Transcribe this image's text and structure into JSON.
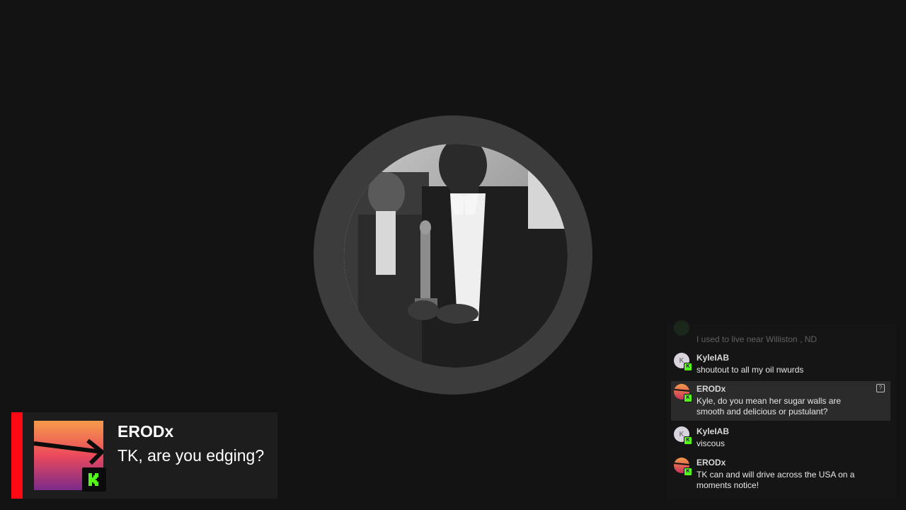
{
  "featured": {
    "username": "ERODx",
    "message": "TK, are you edging?",
    "platform_icon": "kick-logo-icon",
    "accent_color": "#ff0a14"
  },
  "chat": {
    "messages": [
      {
        "user": "",
        "text": "I used to live near Williston , ND",
        "faded": true
      },
      {
        "user": "KyleIAB",
        "text": "shoutout to all my oil nwurds",
        "avatar_letter": "K"
      },
      {
        "user": "ERODx",
        "text": "Kyle, do you mean her sugar walls are smooth and delicious or pustulant?",
        "highlight": true
      },
      {
        "user": "KyleIAB",
        "text": "viscous",
        "avatar_letter": "K"
      },
      {
        "user": "ERODx",
        "text": "TK can and will drive across the USA on a moments notice!"
      }
    ],
    "platform_badge": "K",
    "action_icon": "report-icon"
  },
  "colors": {
    "background": "#131313",
    "ring": "#3c3c3c",
    "kick_green": "#53fc18"
  }
}
